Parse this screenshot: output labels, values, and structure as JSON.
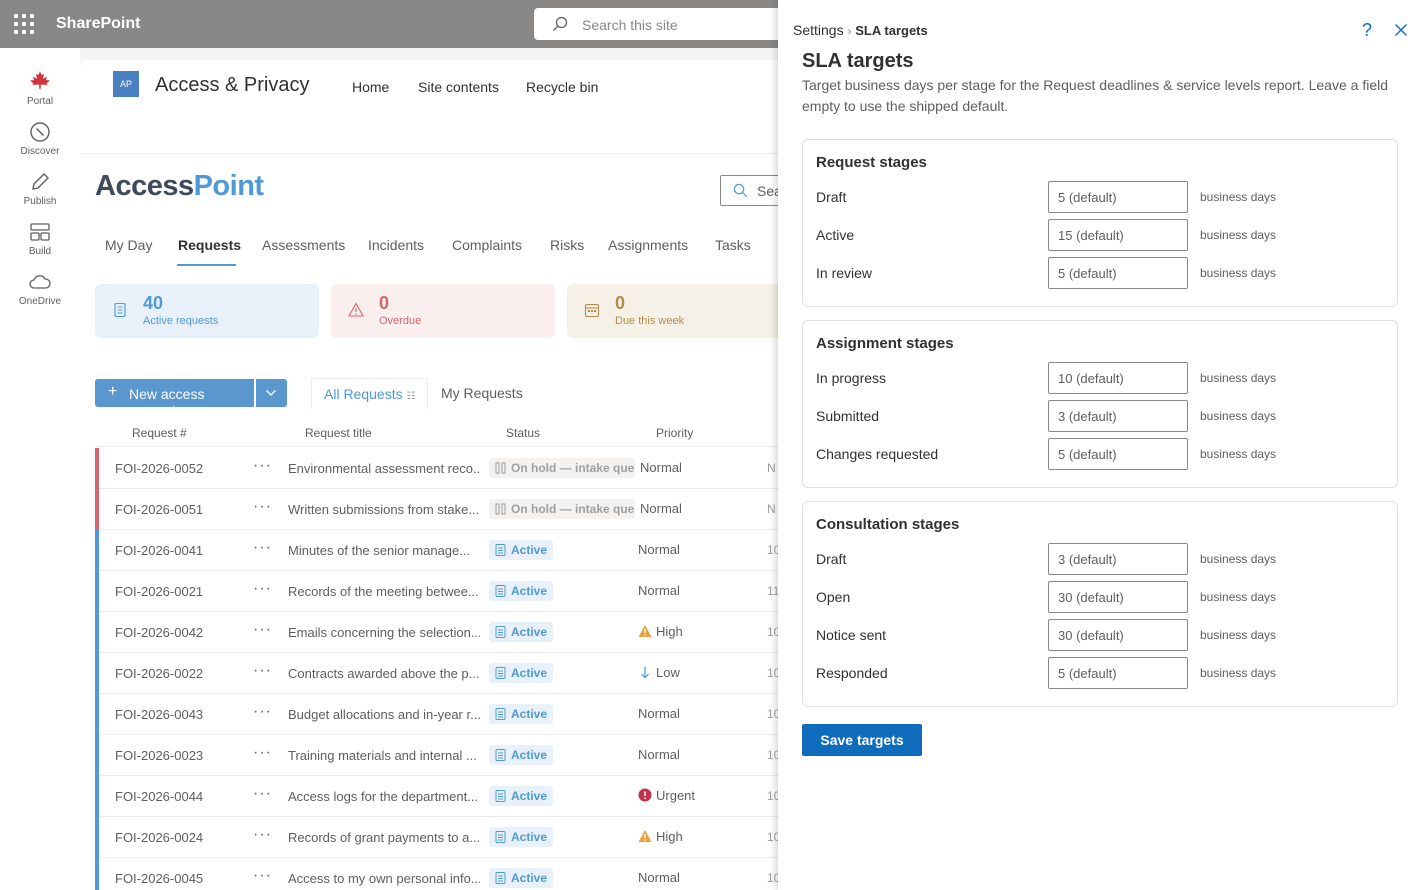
{
  "suitebar": {
    "brand": "SharePoint",
    "search_placeholder": "Search this site"
  },
  "appbar": [
    {
      "label": "Portal",
      "icon": "maple-leaf-icon"
    },
    {
      "label": "Discover",
      "icon": "compass-icon"
    },
    {
      "label": "Publish",
      "icon": "pen-icon"
    },
    {
      "label": "Build",
      "icon": "build-icon"
    },
    {
      "label": "OneDrive",
      "icon": "cloud-icon"
    }
  ],
  "site": {
    "logo_text": "AP",
    "title": "Access & Privacy",
    "nav": [
      "Home",
      "Site contents",
      "Recycle bin"
    ],
    "app_name_a": "Access",
    "app_name_b": "Point",
    "search_placeholder": "Sea",
    "tabs": [
      "My Day",
      "Requests",
      "Assessments",
      "Incidents",
      "Complaints",
      "Risks",
      "Assignments",
      "Tasks"
    ],
    "active_tab": "Requests",
    "cards": [
      {
        "value": "40",
        "label": "Active requests",
        "color": "#4e9ad6",
        "bg": "#e8f1fa"
      },
      {
        "value": "0",
        "label": "Overdue",
        "color": "#d4656a",
        "bg": "#fbeeee"
      },
      {
        "value": "0",
        "label": "Due this week",
        "color": "#b38c4a",
        "bg": "#f6f1e7"
      }
    ],
    "new_button": "New access request",
    "views": [
      "All Requests",
      "My Requests"
    ],
    "columns": [
      "Request #",
      "Request title",
      "Status",
      "Priority"
    ],
    "rows": [
      {
        "num": "FOI-2026-0052",
        "title": "Environmental assessment reco...",
        "status": "On hold — intake queue",
        "status_kind": "hold",
        "priority": "Normal",
        "priority_icon": "",
        "extra": "N",
        "bar": "#d4656a"
      },
      {
        "num": "FOI-2026-0051",
        "title": "Written submissions from stake...",
        "status": "On hold — intake queue",
        "status_kind": "hold",
        "priority": "Normal",
        "priority_icon": "",
        "extra": "N",
        "bar": "#d4656a"
      },
      {
        "num": "FOI-2026-0041",
        "title": "Minutes of the senior manage...",
        "status": "Active",
        "status_kind": "active",
        "priority": "Normal",
        "priority_icon": "",
        "extra": "10",
        "bar": "#4e9ad6"
      },
      {
        "num": "FOI-2026-0021",
        "title": "Records of the meeting betwee...",
        "status": "Active",
        "status_kind": "active",
        "priority": "Normal",
        "priority_icon": "",
        "extra": "11",
        "bar": "#4e9ad6"
      },
      {
        "num": "FOI-2026-0042",
        "title": "Emails concerning the selection...",
        "status": "Active",
        "status_kind": "active",
        "priority": "High",
        "priority_icon": "warning-icon",
        "extra": "10",
        "bar": "#4e9ad6"
      },
      {
        "num": "FOI-2026-0022",
        "title": "Contracts awarded above the p...",
        "status": "Active",
        "status_kind": "active",
        "priority": "Low",
        "priority_icon": "arrow-down-icon",
        "extra": "10",
        "bar": "#4e9ad6"
      },
      {
        "num": "FOI-2026-0043",
        "title": "Budget allocations and in-year r...",
        "status": "Active",
        "status_kind": "active",
        "priority": "Normal",
        "priority_icon": "",
        "extra": "10",
        "bar": "#4e9ad6"
      },
      {
        "num": "FOI-2026-0023",
        "title": "Training materials and internal ...",
        "status": "Active",
        "status_kind": "active",
        "priority": "Normal",
        "priority_icon": "",
        "extra": "10",
        "bar": "#4e9ad6"
      },
      {
        "num": "FOI-2026-0044",
        "title": "Access logs for the department...",
        "status": "Active",
        "status_kind": "active",
        "priority": "Urgent",
        "priority_icon": "urgent-icon",
        "extra": "10",
        "bar": "#4e9ad6"
      },
      {
        "num": "FOI-2026-0024",
        "title": "Records of grant payments to a...",
        "status": "Active",
        "status_kind": "active",
        "priority": "High",
        "priority_icon": "warning-icon",
        "extra": "10",
        "bar": "#4e9ad6"
      },
      {
        "num": "FOI-2026-0045",
        "title": "Access to my own personal info...",
        "status": "Active",
        "status_kind": "active",
        "priority": "Normal",
        "priority_icon": "",
        "extra": "10",
        "bar": "#4e9ad6"
      }
    ]
  },
  "panel": {
    "breadcrumb_parent": "Settings",
    "breadcrumb_sep": "›",
    "breadcrumb_current": "SLA targets",
    "help": "?",
    "title": "SLA targets",
    "description": "Target business days per stage for the Request deadlines & service levels report. Leave a field empty to use the shipped default.",
    "unit": "business days",
    "groups": [
      {
        "heading": "Request stages",
        "fields": [
          {
            "label": "Draft",
            "placeholder": "5 (default)"
          },
          {
            "label": "Active",
            "placeholder": "15 (default)"
          },
          {
            "label": "In review",
            "placeholder": "5 (default)"
          }
        ]
      },
      {
        "heading": "Assignment stages",
        "fields": [
          {
            "label": "In progress",
            "placeholder": "10 (default)"
          },
          {
            "label": "Submitted",
            "placeholder": "3 (default)"
          },
          {
            "label": "Changes requested",
            "placeholder": "5 (default)"
          }
        ]
      },
      {
        "heading": "Consultation stages",
        "fields": [
          {
            "label": "Draft",
            "placeholder": "3 (default)"
          },
          {
            "label": "Open",
            "placeholder": "30 (default)"
          },
          {
            "label": "Notice sent",
            "placeholder": "30 (default)"
          },
          {
            "label": "Responded",
            "placeholder": "5 (default)"
          }
        ]
      }
    ],
    "save_label": "Save targets",
    "accent": "#0f6cbd"
  }
}
